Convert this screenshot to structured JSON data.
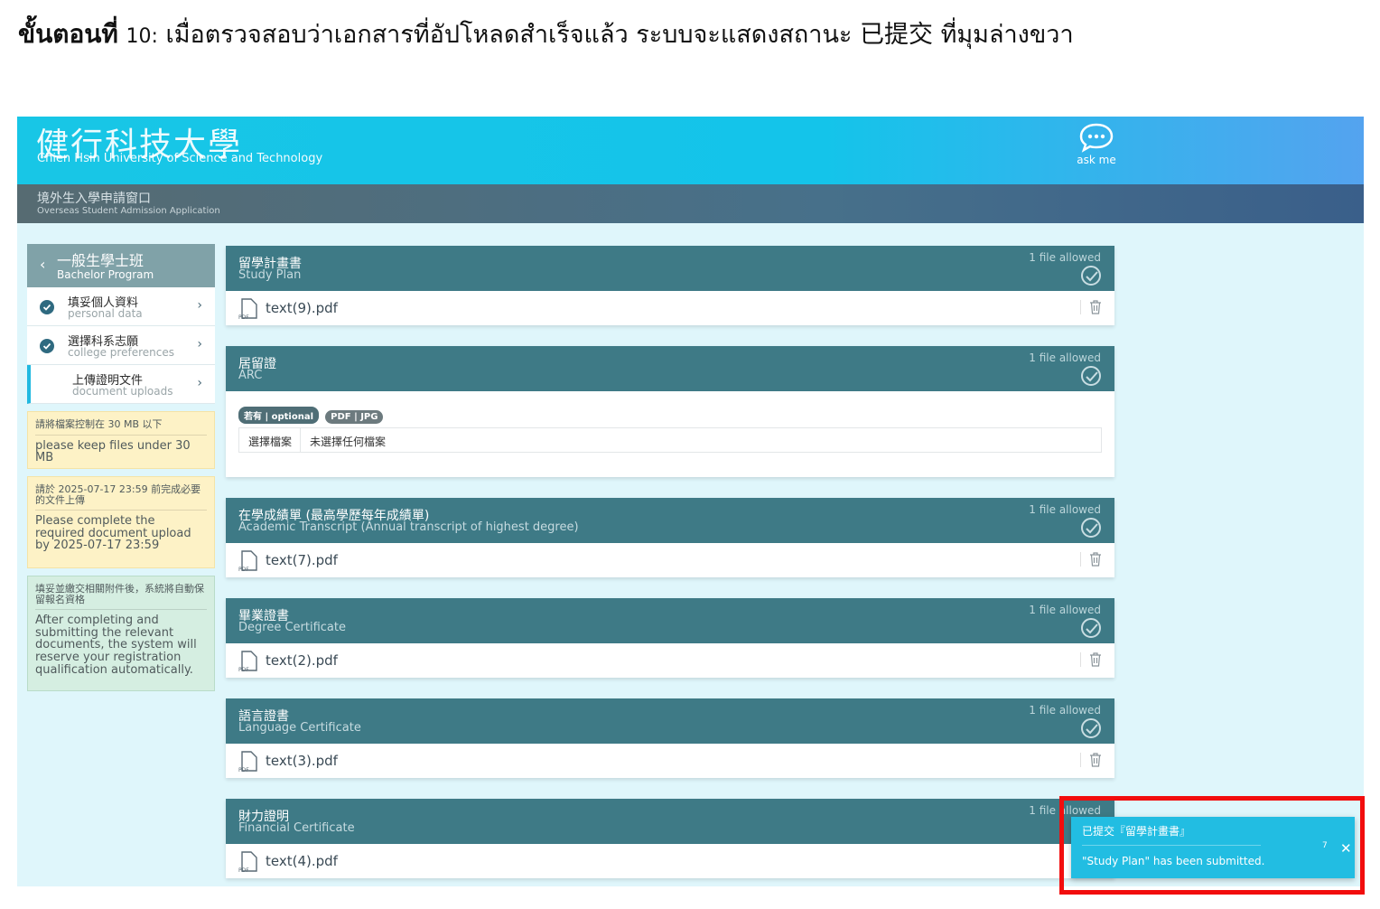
{
  "instruction": {
    "step_label": "ขั้นตอนที่",
    "step_number": "10:",
    "text": "เมื่อตรวจสอบว่าเอกสารที่อัปโหลดสำเร็จแล้ว ระบบจะแสดงสถานะ 已提交 ที่มุมล่างขวา"
  },
  "header": {
    "logo_zh": "健行科技大學",
    "logo_en": "Chien Hsin University of Science and Technology",
    "ask_label": "ask me",
    "ask_icon": "chat-bubble-icon"
  },
  "subheader": {
    "title_zh": "境外生入學申請窗口",
    "title_en": "Overseas Student Admission Application"
  },
  "sidebar": {
    "program_zh": "一般生學士班",
    "program_en": "Bachelor Program",
    "steps": [
      {
        "zh": "填妥個人資料",
        "en": "personal data",
        "done": true
      },
      {
        "zh": "選擇科系志願",
        "en": "college preferences",
        "done": true
      },
      {
        "zh": "上傳證明文件",
        "en": "document uploads",
        "done": false,
        "active": true
      }
    ],
    "notes": [
      {
        "zh": "請將檔案控制在 30 MB 以下",
        "en": "please keep files under 30 MB",
        "color": "yellow"
      },
      {
        "zh": "請於 2025-07-17 23:59 前完成必要的文件上傳",
        "en": "Please complete the required document upload by 2025-07-17 23:59",
        "color": "yellow"
      },
      {
        "zh": "填妥並繳交相關附件後，系統將自動保留報名資格",
        "en": "After completing and submitting the relevant documents, the system will reserve your registration qualification automatically.",
        "color": "green"
      }
    ]
  },
  "cards": [
    {
      "zh": "留學計畫書",
      "en": "Study Plan",
      "allowed": "1 file allowed",
      "file": "text(9).pdf"
    },
    {
      "zh": "居留證",
      "en": "ARC",
      "allowed": "1 file allowed",
      "tag_optional": "若有 | optional",
      "tag_types": "PDF | JPG",
      "choose_btn": "選擇檔案",
      "no_file": "未選擇任何檔案"
    },
    {
      "zh": "在學成績單 (最高學歷每年成績單)",
      "en": "Academic Transcript (Annual transcript of highest degree)",
      "allowed": "1 file allowed",
      "file": "text(7).pdf"
    },
    {
      "zh": "畢業證書",
      "en": "Degree Certificate",
      "allowed": "1 file allowed",
      "file": "text(2).pdf"
    },
    {
      "zh": "語言證書",
      "en": "Language Certificate",
      "allowed": "1 file allowed",
      "file": "text(3).pdf"
    },
    {
      "zh": "財力證明",
      "en": "Financial Certificate",
      "allowed": "1 file allowed",
      "file": "text(4).pdf"
    }
  ],
  "toast": {
    "title": "已提交『留學計畫書』",
    "message": "\"Study Plan\" has been submitted.",
    "count": "7",
    "close": "✕"
  },
  "colors": {
    "topbar": "#14c4ea",
    "card_header": "#3e7a86",
    "toast": "#22bde2",
    "highlight": "#f20d0d"
  }
}
